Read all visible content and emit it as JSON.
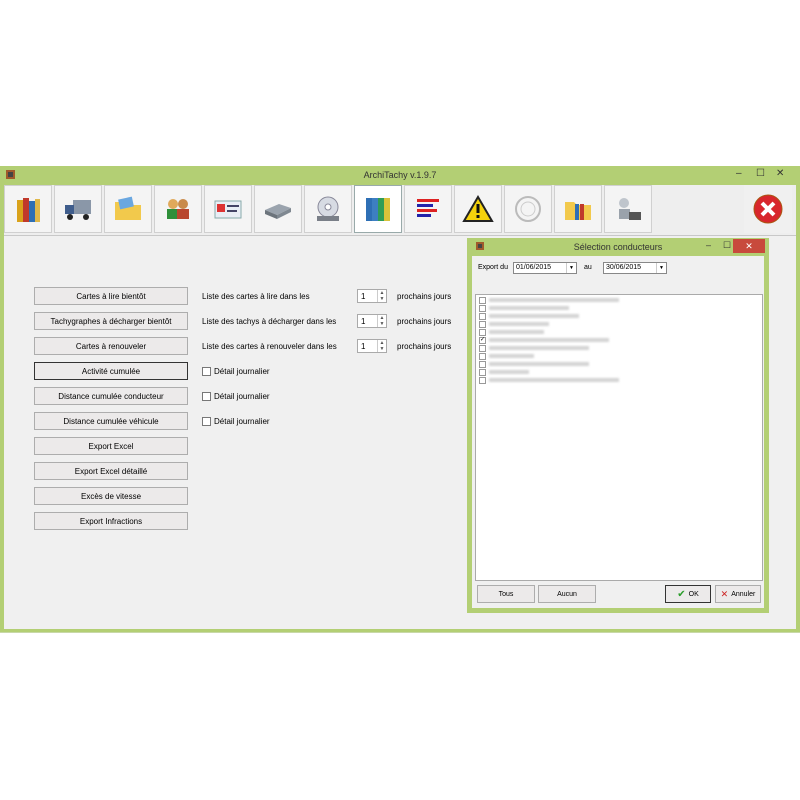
{
  "app": {
    "title": "ArchiTachy v.1.9.7"
  },
  "toolbar": {
    "tools": [
      "books-icon",
      "truck-icon",
      "folder-icon",
      "drivers-icon",
      "card-icon",
      "card-reader-icon",
      "disc-icon",
      "binders-icon",
      "bars-icon",
      "warning-icon",
      "stamp-icon",
      "folder-binders-icon",
      "support-icon"
    ],
    "close_icon": "close-icon"
  },
  "main": {
    "buttons": [
      "Cartes à lire bientôt",
      "Tachygraphes à décharger bientôt",
      "Cartes à renouveler",
      "Activité cumulée",
      "Distance cumulée conducteur",
      "Distance cumulée véhicule",
      "Export Excel",
      "Export Excel détaillé",
      "Excès de vitesse",
      "Export Infractions"
    ],
    "rows": [
      {
        "label": "Liste des cartes à lire dans les",
        "value": "1",
        "suffix": "prochains jours"
      },
      {
        "label": "Liste des tachys à décharger dans les",
        "value": "1",
        "suffix": "prochains jours"
      },
      {
        "label": "Liste des cartes à renouveler dans les",
        "value": "1",
        "suffix": "prochains jours"
      }
    ],
    "checkbox_label": "Détail journalier"
  },
  "dialog": {
    "title": "Sélection conducteurs",
    "export_label": "Export du",
    "date_from": "01/06/2015",
    "to_label": "au",
    "date_to": "30/06/2015",
    "btn_all": "Tous",
    "btn_none": "Aucun",
    "btn_ok": "OK",
    "btn_cancel": "Annuler"
  }
}
